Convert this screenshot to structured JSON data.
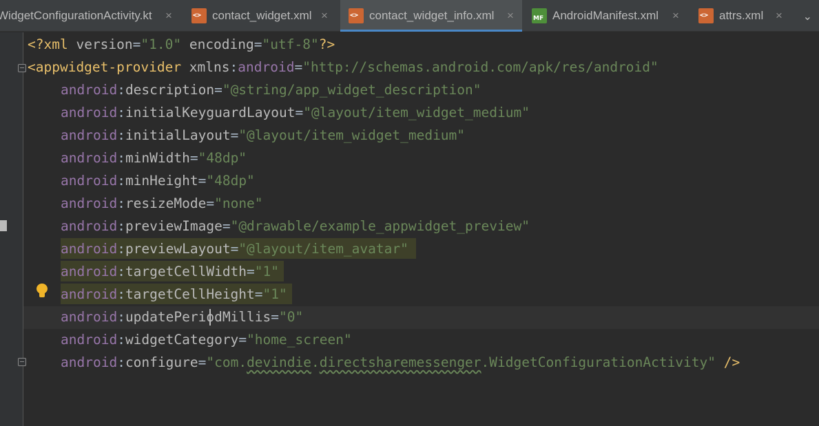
{
  "tabs": [
    {
      "label": "WidgetConfigurationActivity.kt",
      "icon": "kotlin-file-icon",
      "active": false
    },
    {
      "label": "contact_widget.xml",
      "icon": "xml-file-icon",
      "active": false
    },
    {
      "label": "contact_widget_info.xml",
      "icon": "xml-file-icon",
      "active": true
    },
    {
      "label": "AndroidManifest.xml",
      "icon": "manifest-file-icon",
      "active": false
    },
    {
      "label": "attrs.xml",
      "icon": "xml-file-icon",
      "active": false
    }
  ],
  "tab_close_glyph": "×",
  "tab_overflow_glyph": "⌄",
  "code": {
    "line1": {
      "open": "<?",
      "xml": "xml",
      "version_attr": " version",
      "eq1": "=",
      "version_val": "\"1.0\"",
      "enc_attr": " encoding",
      "eq2": "=",
      "enc_val": "\"utf-8\"",
      "close": "?>"
    },
    "line2": {
      "tag": "<appwidget-provider",
      "xmlns": " xmlns",
      "colon": ":",
      "ns": "android",
      "eq": "=",
      "val": "\"http://schemas.android.com/apk/res/android\""
    },
    "attrs": [
      {
        "ns": "android",
        "name": "description",
        "value": "\"@string/app_widget_description\""
      },
      {
        "ns": "android",
        "name": "initialKeyguardLayout",
        "value": "\"@layout/item_widget_medium\""
      },
      {
        "ns": "android",
        "name": "initialLayout",
        "value": "\"@layout/item_widget_medium\""
      },
      {
        "ns": "android",
        "name": "minWidth",
        "value": "\"48dp\""
      },
      {
        "ns": "android",
        "name": "minHeight",
        "value": "\"48dp\""
      },
      {
        "ns": "android",
        "name": "resizeMode",
        "value": "\"none\""
      },
      {
        "ns": "android",
        "name": "previewImage",
        "value": "\"@drawable/example_appwidget_preview\""
      },
      {
        "ns": "android",
        "name": "previewLayout",
        "value": "\"@layout/item_avatar\""
      },
      {
        "ns": "android",
        "name": "targetCellWidth",
        "value": "\"1\""
      },
      {
        "ns": "android",
        "name": "targetCellHeight",
        "value": "\"1\""
      },
      {
        "ns": "android",
        "name": "updatePeriodMillis",
        "value": "\"0\""
      },
      {
        "ns": "android",
        "name": "widgetCategory",
        "value": "\"home_screen\""
      },
      {
        "ns": "android",
        "name": "configure",
        "value_a": "\"com.",
        "value_b": "devindie",
        "value_c": ".",
        "value_d": "directsharemessenger",
        "value_e": ".WidgetConfigurationActivity\"",
        "close": " />"
      }
    ]
  },
  "colors": {
    "background": "#2b2b2b",
    "tab_accent": "#4a88c7",
    "string": "#6a8759",
    "namespace": "#9876aa",
    "tag": "#e8bf6a"
  }
}
